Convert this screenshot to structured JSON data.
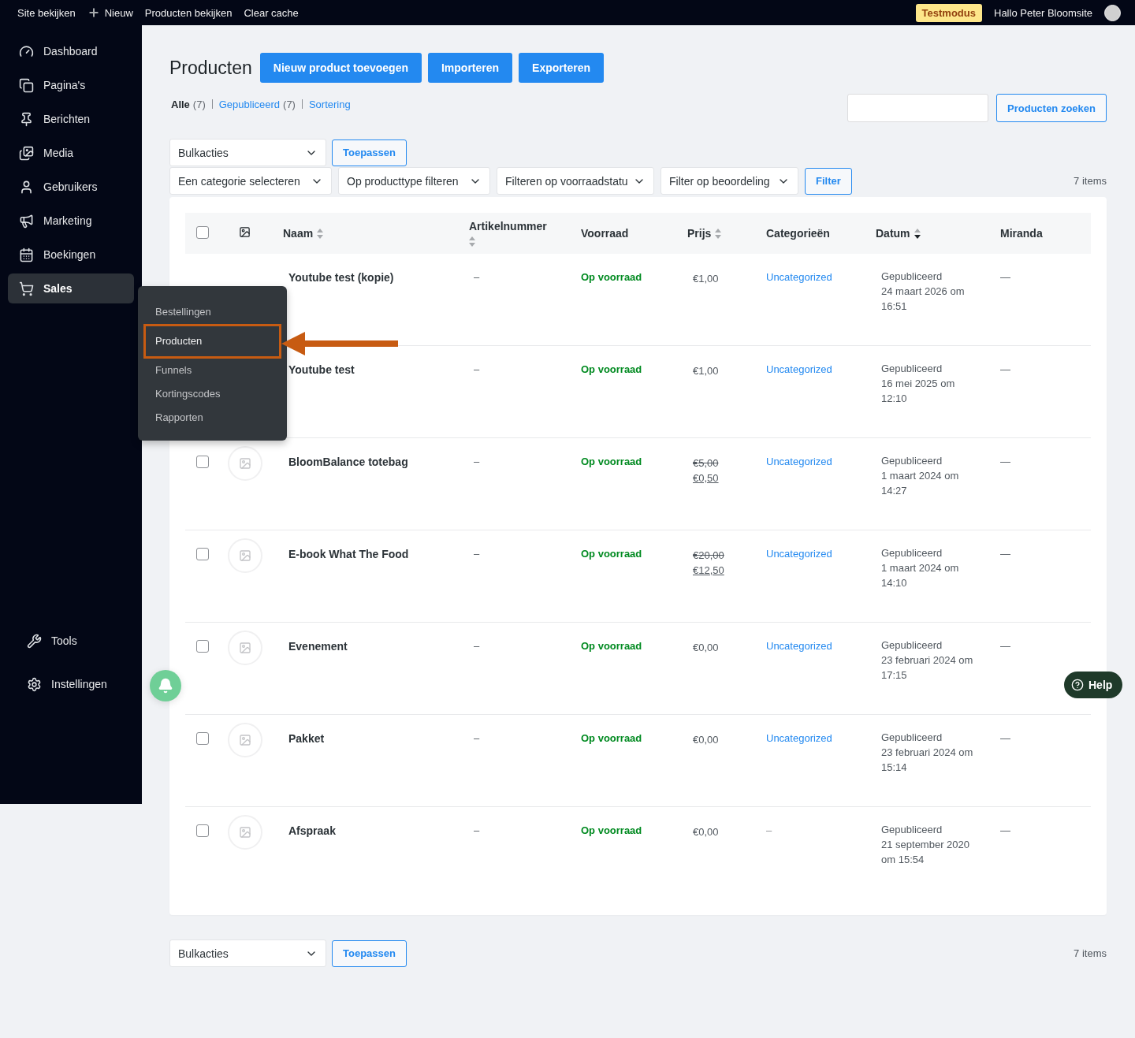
{
  "top_bar": {
    "left_items": [
      {
        "label": "Site bekijken",
        "kind": "link"
      },
      {
        "label": "Nieuw",
        "kind": "new"
      },
      {
        "label": "Producten bekijken",
        "kind": "link"
      },
      {
        "label": "Clear cache",
        "kind": "link"
      }
    ],
    "badge": "Testmodus",
    "greeting": "Hallo Peter Bloomsite"
  },
  "sidebar": {
    "items": [
      {
        "label": "Dashboard",
        "selected": false
      },
      {
        "label": "Pagina's",
        "selected": false
      },
      {
        "label": "Berichten",
        "selected": false
      },
      {
        "label": "Media",
        "selected": false
      },
      {
        "label": "Gebruikers",
        "selected": false
      },
      {
        "label": "Marketing",
        "selected": false
      },
      {
        "label": "Boekingen",
        "selected": false
      },
      {
        "label": "Sales",
        "selected": true
      }
    ],
    "bottom_items": [
      {
        "label": "Tools",
        "selected": false
      },
      {
        "label": "Instellingen",
        "selected": false
      }
    ],
    "flyout": [
      {
        "label": "Bestellingen",
        "selected": false,
        "highlighted": false
      },
      {
        "label": "Producten",
        "selected": true,
        "highlighted": true
      },
      {
        "label": "Funnels",
        "selected": false,
        "highlighted": false
      },
      {
        "label": "Kortingscodes",
        "selected": false,
        "highlighted": false
      },
      {
        "label": "Rapporten",
        "selected": false,
        "highlighted": false
      }
    ]
  },
  "page": {
    "title": "Producten",
    "actions": [
      "Nieuw product toevoegen",
      "Importeren",
      "Exporteren"
    ],
    "views": [
      {
        "label": "Alle",
        "count": "(7)",
        "selected": true
      },
      {
        "label": "Gepubliceerd",
        "count": "(7)",
        "selected": false
      },
      {
        "label": "Sortering",
        "selected": false
      }
    ],
    "search_button": "Producten zoeken"
  },
  "bulk_top": {
    "select": "Bulkacties",
    "apply": "Toepassen"
  },
  "filters": {
    "selects": [
      "Een categorie selecteren",
      "Op producttype filteren",
      "Filteren op voorraadstatu",
      "Filter op beoordeling"
    ],
    "button": "Filter",
    "count": "7 items"
  },
  "table": {
    "select_all_checked": false,
    "columns": [
      {
        "kind": "image"
      },
      {
        "kind": "text",
        "label": "Naam",
        "sortable": true,
        "sorted": false
      },
      {
        "kind": "text",
        "label": "Artikelnummer",
        "sortable": true,
        "sorted": false
      },
      {
        "kind": "text",
        "label": "Voorraad"
      },
      {
        "kind": "text",
        "label": "Prijs",
        "sortable": true,
        "sorted": false
      },
      {
        "kind": "text",
        "label": "Categorieën"
      },
      {
        "kind": "text",
        "label": "Datum",
        "sortable": true,
        "sorted": true
      },
      {
        "kind": "text",
        "label": "Miranda"
      }
    ],
    "rows": [
      {
        "name": "Youtube test (kopie)",
        "sku": "–",
        "stock": "Op voorraad",
        "prices": [
          {
            "text": "€1,00",
            "struck": false
          }
        ],
        "category": {
          "text": "Uncategorized",
          "link": true
        },
        "status": "Gepubliceerd",
        "date": "24 maart 2026 om 16:51",
        "miranda": "—"
      },
      {
        "name": "Youtube test",
        "sku": "–",
        "stock": "Op voorraad",
        "prices": [
          {
            "text": "€1,00",
            "struck": false
          }
        ],
        "category": {
          "text": "Uncategorized",
          "link": true
        },
        "status": "Gepubliceerd",
        "date": "16 mei 2025 om 12:10",
        "miranda": "—"
      },
      {
        "name": "BloomBalance totebag",
        "checked": false,
        "sku": "–",
        "stock": "Op voorraad",
        "prices": [
          {
            "text": "€5,00",
            "struck": true
          },
          {
            "text": "€0,50",
            "struck": false
          }
        ],
        "category": {
          "text": "Uncategorized",
          "link": true
        },
        "status": "Gepubliceerd",
        "date": "1 maart 2024 om 14:27",
        "miranda": "—"
      },
      {
        "name": "E-book What The Food",
        "checked": false,
        "sku": "–",
        "stock": "Op voorraad",
        "prices": [
          {
            "text": "€20,00",
            "struck": true
          },
          {
            "text": "€12,50",
            "struck": false
          }
        ],
        "category": {
          "text": "Uncategorized",
          "link": true
        },
        "status": "Gepubliceerd",
        "date": "1 maart 2024 om 14:10",
        "miranda": "—"
      },
      {
        "name": "Evenement",
        "checked": false,
        "sku": "–",
        "stock": "Op voorraad",
        "prices": [
          {
            "text": "€0,00",
            "struck": false
          }
        ],
        "category": {
          "text": "Uncategorized",
          "link": true
        },
        "status": "Gepubliceerd",
        "date": "23 februari 2024 om 17:15",
        "miranda": "—"
      },
      {
        "name": "Pakket",
        "checked": false,
        "sku": "–",
        "stock": "Op voorraad",
        "prices": [
          {
            "text": "€0,00",
            "struck": false
          }
        ],
        "category": {
          "text": "Uncategorized",
          "link": true
        },
        "status": "Gepubliceerd",
        "date": "23 februari 2024 om 15:14",
        "miranda": "—"
      },
      {
        "name": "Afspraak",
        "checked": false,
        "sku": "–",
        "stock": "Op voorraad",
        "prices": [
          {
            "text": "€0,00",
            "struck": false
          }
        ],
        "category": {
          "text": "–",
          "link": false
        },
        "status": "Gepubliceerd",
        "date": "21 september 2020 om 15:54",
        "miranda": "—"
      }
    ]
  },
  "bulk_bottom": {
    "select": "Bulkacties",
    "apply": "Toepassen",
    "count": "7 items"
  },
  "help": "Help"
}
